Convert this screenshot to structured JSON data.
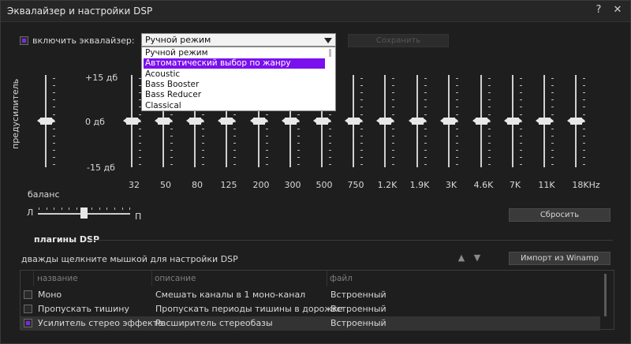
{
  "window": {
    "title": "Эквалайзер и настройки DSP"
  },
  "header": {
    "enable_label": "включить эквалайзер:",
    "enable_checked": true,
    "preset_value": "Ручной режим",
    "save_label": "Сохранить"
  },
  "dropdown": {
    "items": [
      "Ручной режим",
      "Автоматический выбор по жанру",
      "Acoustic",
      "Bass Booster",
      "Bass Reducer",
      "Classical"
    ],
    "selected_index": 1
  },
  "eq": {
    "preamp_label": "предусилитель",
    "db_top": "+15 дб",
    "db_mid": "0 дб",
    "db_bot": "-15 дб",
    "bands": [
      "32",
      "50",
      "80",
      "125",
      "200",
      "300",
      "500",
      "750",
      "1.2K",
      "1.9K",
      "3K",
      "4.6K",
      "7K",
      "11K",
      "18KHz"
    ],
    "band_levels_db": [
      0,
      0,
      0,
      0,
      0,
      0,
      0,
      0,
      0,
      0,
      0,
      0,
      0,
      0,
      0
    ],
    "preamp_level_db": 0,
    "balance_label": "баланс",
    "balance_left": "Л",
    "balance_right": "П",
    "balance_value": 0,
    "reset_label": "Сбросить"
  },
  "dsp": {
    "section_title": "плагины DSP",
    "hint": "дважды щелкните мышкой для настройки DSP",
    "import_label": "Импорт из Winamp",
    "columns": [
      "название",
      "описание",
      "файл"
    ],
    "rows": [
      {
        "name": "Моно",
        "desc": "Смешать каналы в 1 моно-канал",
        "file": "Встроенный",
        "checked": false
      },
      {
        "name": "Пропускать тишину",
        "desc": "Пропускать периоды тишины в дорожке",
        "file": "Встроенный",
        "checked": false
      },
      {
        "name": "Усилитель стерео эффекта",
        "desc": "Расширитель стереобазы",
        "file": "Встроенный",
        "checked": true
      }
    ]
  },
  "colors": {
    "accent": "#7a10ee",
    "background": "#1e1e1e"
  }
}
